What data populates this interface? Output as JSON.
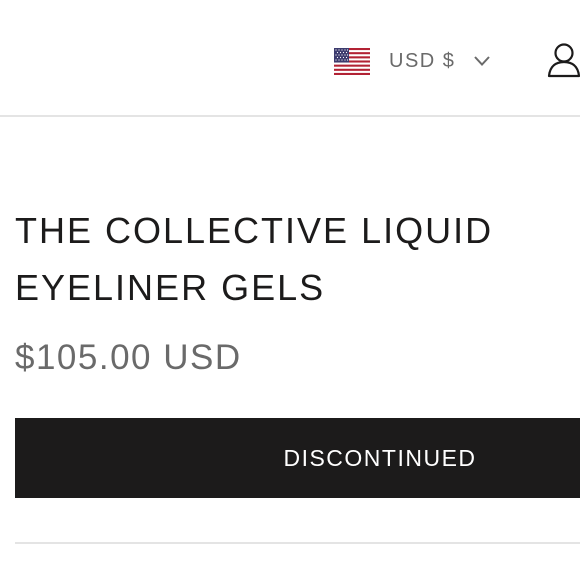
{
  "header": {
    "currency": {
      "flag_icon": "us-flag-icon",
      "label": "USD $",
      "chevron_icon": "chevron-down-icon"
    },
    "account_icon": "user-icon"
  },
  "product": {
    "title": "THE COLLECTIVE LIQUID EYELINER GELS",
    "price": "$105.00 USD",
    "button_label": "DISCONTINUED"
  },
  "colors": {
    "text": "#1c1b1b",
    "muted_text": "#6a6a6a",
    "button_bg": "#1c1b1b",
    "button_text": "#ffffff",
    "divider": "#e4e4e4"
  }
}
